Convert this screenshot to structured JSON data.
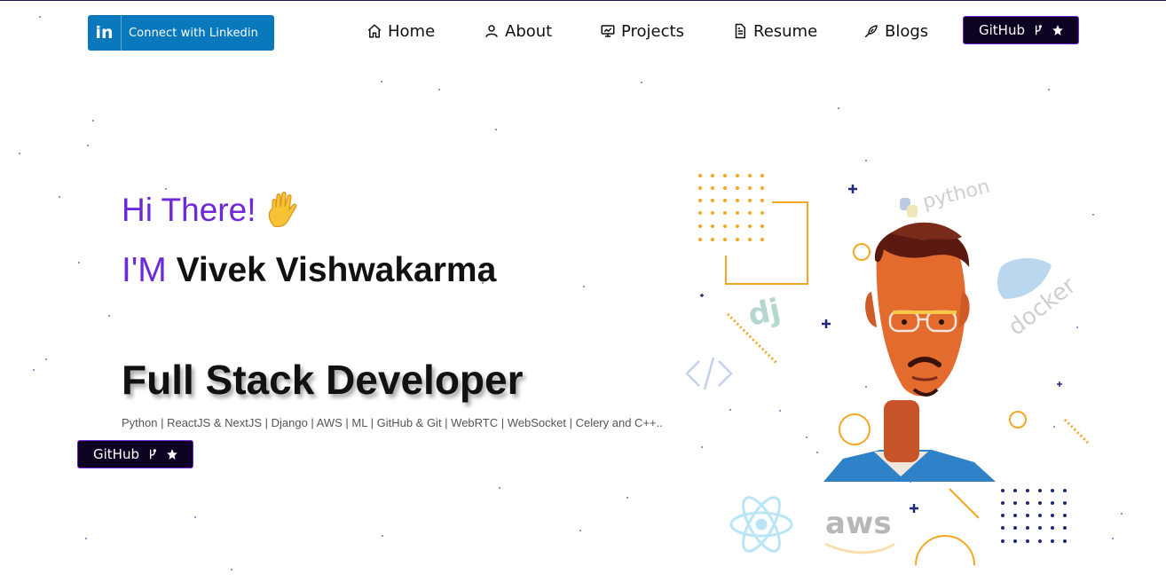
{
  "navbar": {
    "linkedin_label": "Connect with Linkedin",
    "linkedin_logo_text": "in",
    "items": [
      {
        "label": "Home",
        "icon": "home-icon"
      },
      {
        "label": "About",
        "icon": "user-icon"
      },
      {
        "label": "Projects",
        "icon": "projects-icon"
      },
      {
        "label": "Resume",
        "icon": "document-icon"
      },
      {
        "label": "Blogs",
        "icon": "blog-icon"
      }
    ],
    "github_label": "GitHub"
  },
  "hero": {
    "greeting": "Hi There!",
    "im_prefix": "I'M",
    "name": "Vivek Vishwakarma",
    "role": "Full Stack Developer",
    "skills": "Python | ReactJS & NextJS | Django | AWS | ML | GitHub & Git | WebRTC | WebSocket | Celery and C++..",
    "github_label": "GitHub"
  },
  "illustration": {
    "tech_labels": [
      "python",
      "docker",
      "aws"
    ],
    "colors": {
      "orange": "#f5a623",
      "navy": "#1e2a78",
      "purple": "#6d28d9"
    }
  }
}
